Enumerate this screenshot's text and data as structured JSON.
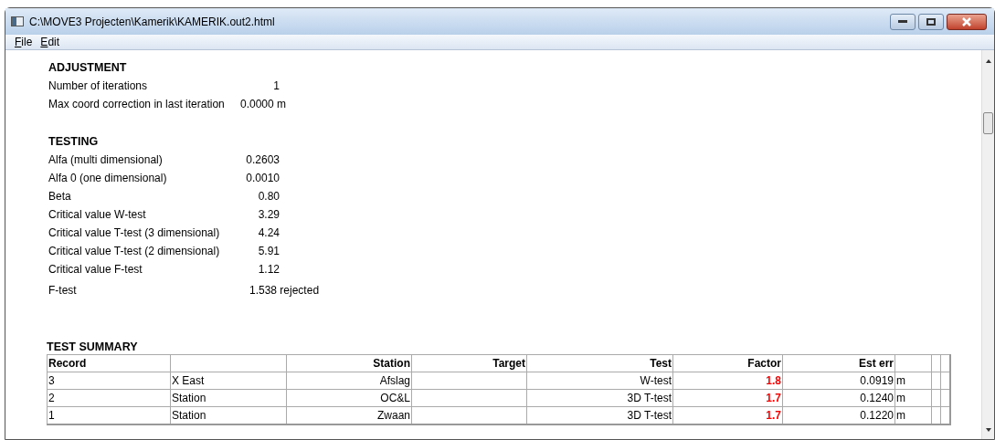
{
  "window": {
    "title": "C:\\MOVE3 Projecten\\Kamerik\\KAMERIK.out2.html"
  },
  "menu": [
    {
      "label": "File"
    },
    {
      "label": "Edit"
    }
  ],
  "adjustment": {
    "heading": "ADJUSTMENT",
    "rows": [
      {
        "label": "Number of iterations",
        "value": "1"
      },
      {
        "label": "Max coord correction in last iteration",
        "value": "0.0000 m"
      }
    ]
  },
  "testing": {
    "heading": "TESTING",
    "rows": [
      {
        "label": "Alfa (multi dimensional)",
        "value": "0.2603"
      },
      {
        "label": "Alfa 0 (one dimensional)",
        "value": "0.0010"
      },
      {
        "label": "Beta",
        "value": "0.80"
      },
      {
        "label": "Critical value W-test",
        "value": "3.29"
      },
      {
        "label": "Critical value T-test (3 dimensional)",
        "value": "4.24"
      },
      {
        "label": "Critical value T-test (2 dimensional)",
        "value": "5.91"
      },
      {
        "label": "Critical value F-test",
        "value": "1.12"
      }
    ],
    "f_test": {
      "label": "F-test",
      "value": "1.538 rejected"
    }
  },
  "test_summary": {
    "heading": "TEST SUMMARY",
    "columns": [
      "Record",
      "",
      "Station",
      "Target",
      "Test",
      "Factor",
      "Est err"
    ],
    "rows": [
      {
        "record": "3",
        "type": "X East",
        "station": "Afslag",
        "test": "W-test",
        "factor": "1.8",
        "flagged": true,
        "est_err": "0.0919",
        "unit": "m"
      },
      {
        "record": "2",
        "type": "Station",
        "station": "OC&L",
        "test": "3D T-test",
        "factor": "1.7",
        "flagged": true,
        "est_err": "0.1240",
        "unit": "m"
      },
      {
        "record": "1",
        "type": "Station",
        "station": "Zwaan",
        "test": "3D T-test",
        "factor": "1.7",
        "flagged": true,
        "est_err": "0.1220",
        "unit": "m"
      }
    ]
  }
}
